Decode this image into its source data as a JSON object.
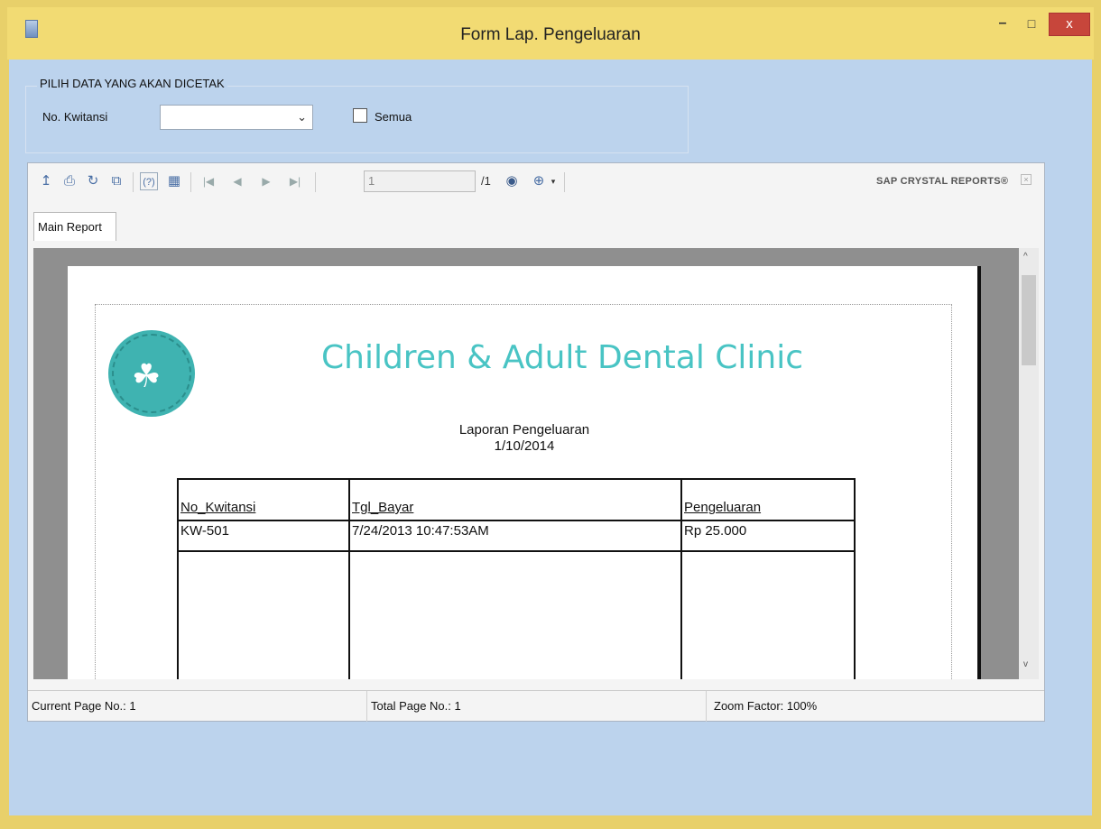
{
  "window": {
    "title": "Form Lap. Pengeluaran",
    "minimize_glyph": "–",
    "maximize_glyph": "□",
    "close_glyph": "x"
  },
  "filter": {
    "group_label": "PILIH DATA YANG AKAN DICETAK",
    "kwitansi_label": "No. Kwitansi",
    "kwitansi_value": "",
    "all_label": "Semua",
    "all_checked": false
  },
  "toolbar": {
    "icons": [
      "export-icon",
      "print-icon",
      "refresh-icon",
      "copy-icon",
      "help-icon",
      "group-tree-icon",
      "first-page-icon",
      "prev-page-icon",
      "next-page-icon",
      "last-page-icon",
      "find-icon",
      "zoom-icon"
    ],
    "page_number": "1",
    "page_total": "/1",
    "brand": "SAP CRYSTAL REPORTS®"
  },
  "tabs": [
    {
      "label": "Main Report"
    }
  ],
  "report": {
    "clinic_name": "Children & Adult Dental Clinic",
    "logo_text": "Children & Adult Dental Clinic",
    "title": "Laporan Pengeluaran",
    "date": "1/10/2014",
    "columns": [
      "No_Kwitansi",
      "Tgl_Bayar",
      "Pengeluaran"
    ],
    "rows": [
      [
        "KW-501",
        "7/24/2013  10:47:53AM",
        "Rp 25.000"
      ]
    ]
  },
  "status": {
    "current_page": "Current Page No.: 1",
    "total_page": "Total Page No.: 1",
    "zoom": "Zoom Factor: 100%"
  },
  "colors": {
    "titlebar": "#f2db73",
    "client": "#bcd3ed",
    "close_button": "#c7463b",
    "clinic_name": "#49c4c4"
  }
}
